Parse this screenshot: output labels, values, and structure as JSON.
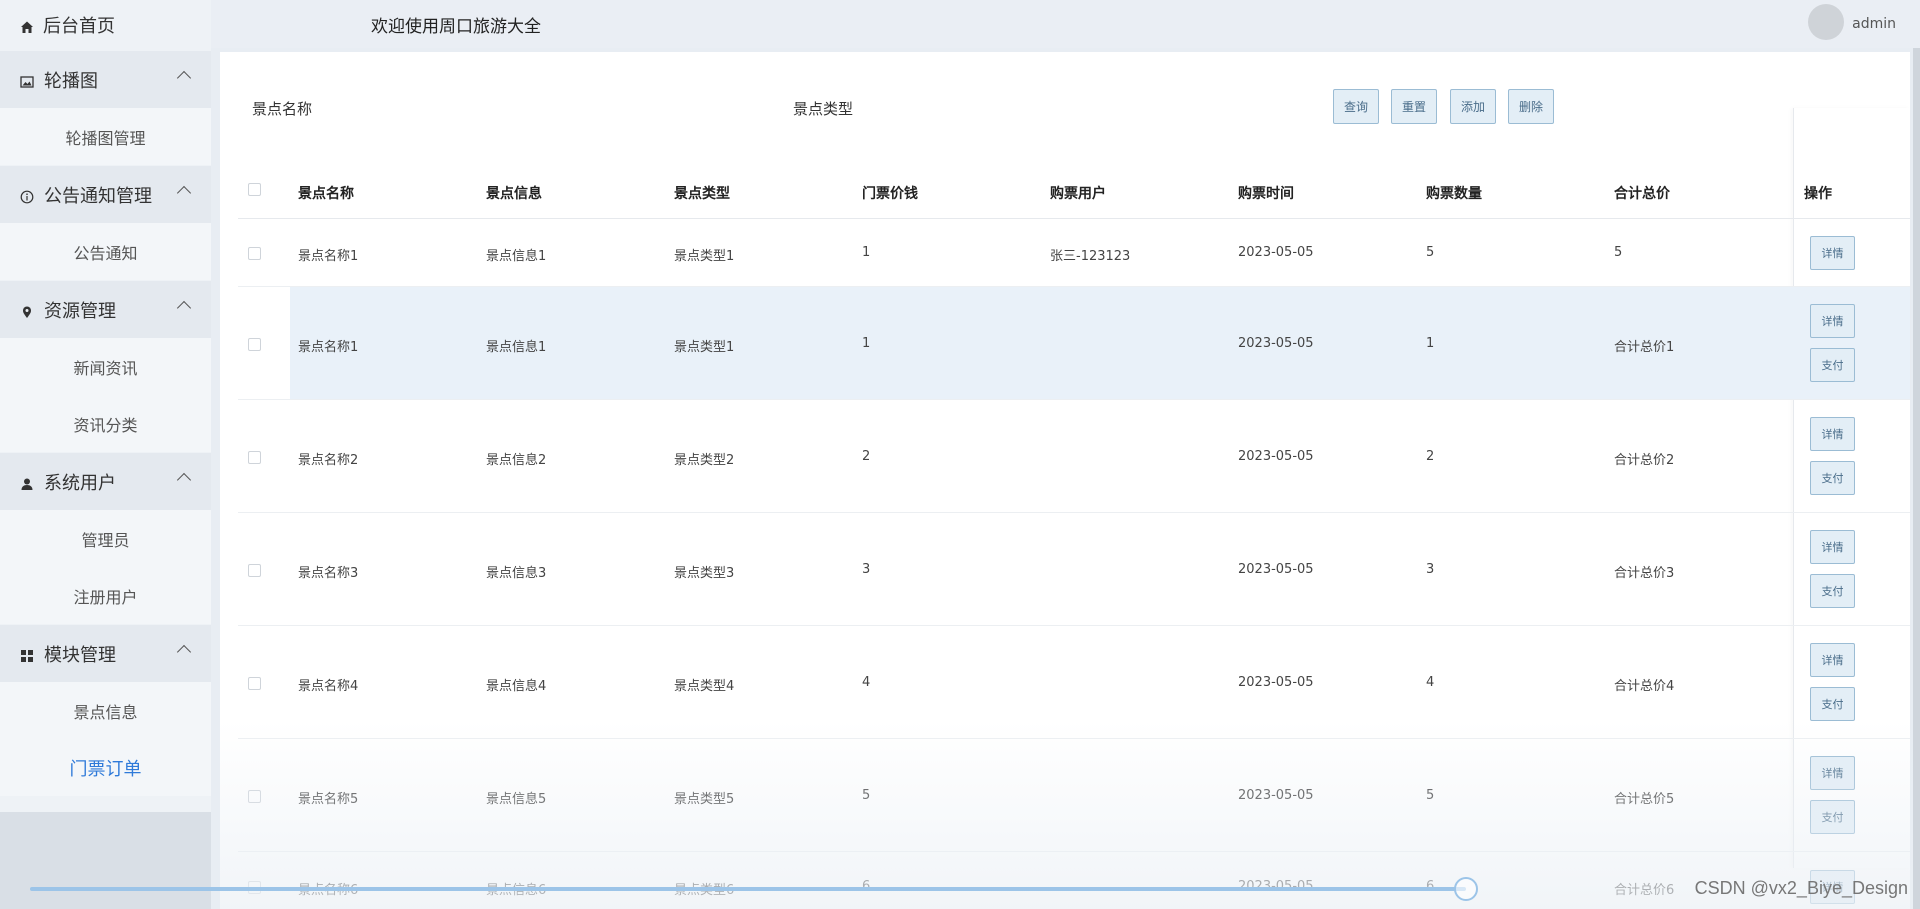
{
  "sidebar": {
    "home": "后台首页",
    "groups": [
      {
        "label": "轮播图",
        "icon": "image-icon",
        "items": [
          "轮播图管理"
        ]
      },
      {
        "label": "公告通知管理",
        "icon": "info-icon",
        "items": [
          "公告通知"
        ]
      },
      {
        "label": "资源管理",
        "icon": "location-icon",
        "items": [
          "新闻资讯",
          "资讯分类"
        ]
      },
      {
        "label": "系统用户",
        "icon": "user-icon",
        "items": [
          "管理员",
          "注册用户"
        ]
      },
      {
        "label": "模块管理",
        "icon": "grid-icon",
        "items": [
          "景点信息",
          "门票订单"
        ]
      }
    ],
    "active_item": "门票订单"
  },
  "header": {
    "title": "欢迎使用周口旅游大全",
    "user": "admin"
  },
  "search": {
    "name_label": "景点名称",
    "type_label": "景点类型",
    "buttons": [
      "查询",
      "重置",
      "添加",
      "删除"
    ]
  },
  "table": {
    "columns": [
      "景点名称",
      "景点信息",
      "景点类型",
      "门票价钱",
      "购票用户",
      "购票时间",
      "购票数量",
      "合计总价",
      "操作"
    ],
    "rows": [
      {
        "name": "景点名称1",
        "info": "景点信息1",
        "type": "景点类型1",
        "price": "1",
        "user": "张三-123123",
        "time": "2023-05-05",
        "qty": "5",
        "total": "5",
        "actions": [
          "详情"
        ]
      },
      {
        "name": "景点名称1",
        "info": "景点信息1",
        "type": "景点类型1",
        "price": "1",
        "user": "",
        "time": "2023-05-05",
        "qty": "1",
        "total": "合计总价1",
        "actions": [
          "详情",
          "支付"
        ]
      },
      {
        "name": "景点名称2",
        "info": "景点信息2",
        "type": "景点类型2",
        "price": "2",
        "user": "",
        "time": "2023-05-05",
        "qty": "2",
        "total": "合计总价2",
        "actions": [
          "详情",
          "支付"
        ]
      },
      {
        "name": "景点名称3",
        "info": "景点信息3",
        "type": "景点类型3",
        "price": "3",
        "user": "",
        "time": "2023-05-05",
        "qty": "3",
        "total": "合计总价3",
        "actions": [
          "详情",
          "支付"
        ]
      },
      {
        "name": "景点名称4",
        "info": "景点信息4",
        "type": "景点类型4",
        "price": "4",
        "user": "",
        "time": "2023-05-05",
        "qty": "4",
        "total": "合计总价4",
        "actions": [
          "详情",
          "支付"
        ]
      },
      {
        "name": "景点名称5",
        "info": "景点信息5",
        "type": "景点类型5",
        "price": "5",
        "user": "",
        "time": "2023-05-05",
        "qty": "5",
        "total": "合计总价5",
        "actions": [
          "详情",
          "支付"
        ]
      },
      {
        "name": "景点名称6",
        "info": "景点信息6",
        "type": "景点类型6",
        "price": "6",
        "user": "",
        "time": "2023-05-05",
        "qty": "6",
        "total": "合计总价6",
        "actions": [
          "详情"
        ]
      }
    ]
  },
  "player": {
    "progress": 0.97
  },
  "watermark": "CSDN @vx2_Biye_Design",
  "colors": {
    "accent": "#2f7ad9",
    "button_bg": "#e3eef6",
    "button_border": "#9bbcd4",
    "highlight_row": "#e9f1f9"
  }
}
